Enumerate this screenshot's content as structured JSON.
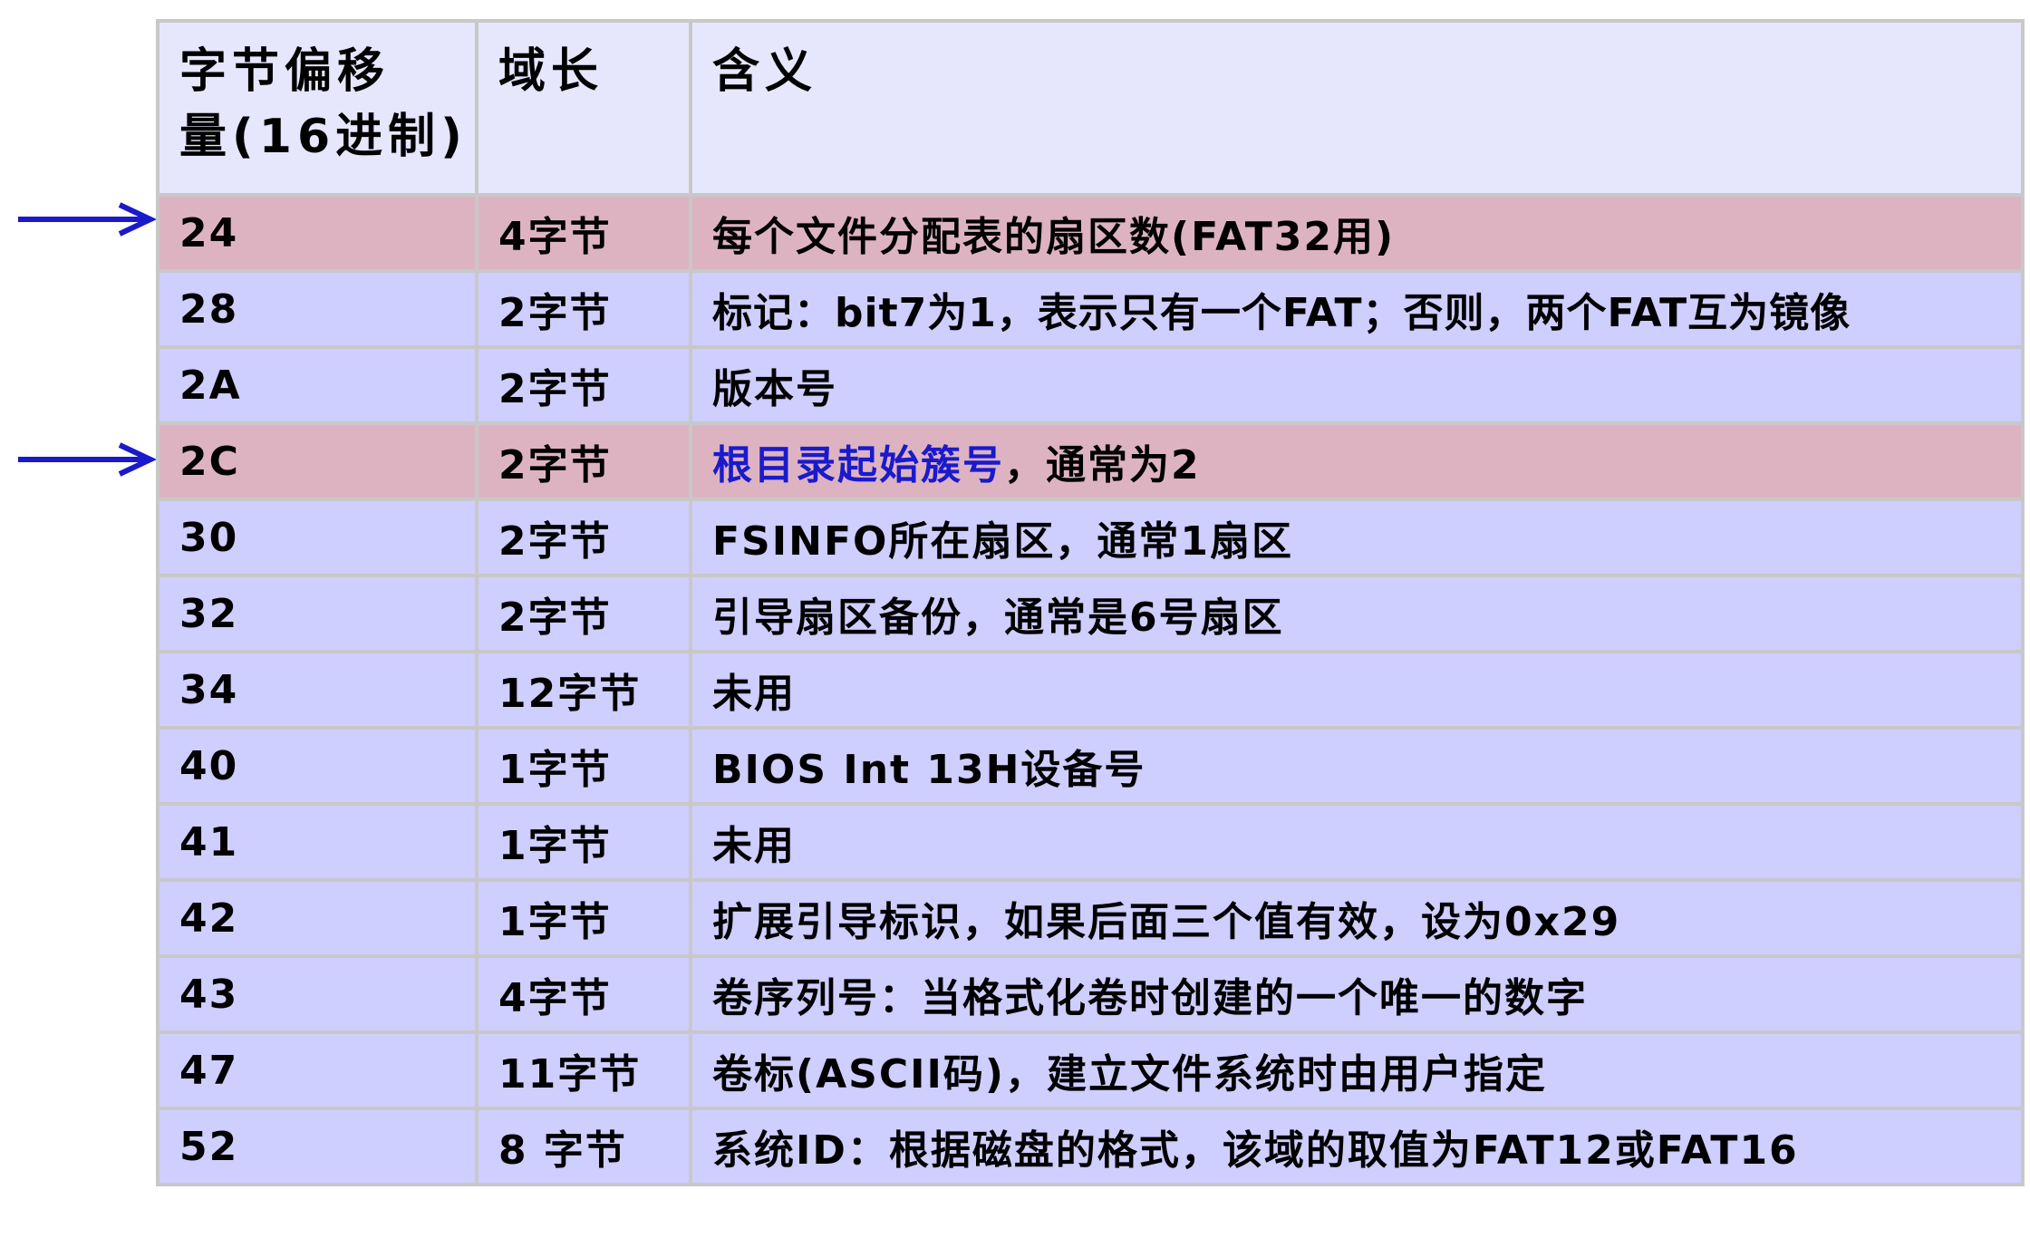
{
  "header": {
    "offset_line1": "字节偏移",
    "offset_line2": "量(16进制)",
    "length": "域长",
    "meaning": "含义"
  },
  "rows": [
    {
      "offset": "24",
      "length": "4字节",
      "meaning": "每个文件分配表的扇区数(FAT32用)",
      "highlight": true
    },
    {
      "offset": "28",
      "length": "2字节",
      "meaning": "标记：bit7为1，表示只有一个FAT；否则，两个FAT互为镜像",
      "highlight": false
    },
    {
      "offset": "2A",
      "length": "2字节",
      "meaning": "版本号",
      "highlight": false
    },
    {
      "offset": "2C",
      "length": "2字节",
      "meaning_blue": "根目录起始簇号",
      "meaning_rest": "，通常为2",
      "highlight": true
    },
    {
      "offset": "30",
      "length": "2字节",
      "meaning": "FSINFO所在扇区，通常1扇区",
      "highlight": false
    },
    {
      "offset": "32",
      "length": "2字节",
      "meaning": "引导扇区备份，通常是6号扇区",
      "highlight": false
    },
    {
      "offset": "34",
      "length": "12字节",
      "meaning": "未用",
      "highlight": false
    },
    {
      "offset": "40",
      "length": "1字节",
      "meaning": "BIOS Int 13H设备号",
      "highlight": false
    },
    {
      "offset": "41",
      "length": "1字节",
      "meaning": "未用",
      "highlight": false
    },
    {
      "offset": "42",
      "length": "1字节",
      "meaning": "扩展引导标识，如果后面三个值有效，设为0x29",
      "highlight": false
    },
    {
      "offset": "43",
      "length": "4字节",
      "meaning": "卷序列号：当格式化卷时创建的一个唯一的数字",
      "highlight": false
    },
    {
      "offset": "47",
      "length": "11字节",
      "meaning": "卷标(ASCII码)，建立文件系统时由用户指定",
      "highlight": false
    },
    {
      "offset": "52",
      "length": "8 字节",
      "meaning": "系统ID：根据磁盘的格式，该域的取值为FAT12或FAT16",
      "highlight": false
    }
  ],
  "colors": {
    "header_bg": "#e6e6fc",
    "row_bg": "#ceceff",
    "highlight_bg": "#ddb3c2",
    "arrow": "#1a1acc",
    "emphasis_text": "#1a1acc"
  },
  "icons": {
    "row_pointer": "right-arrow-icon"
  }
}
